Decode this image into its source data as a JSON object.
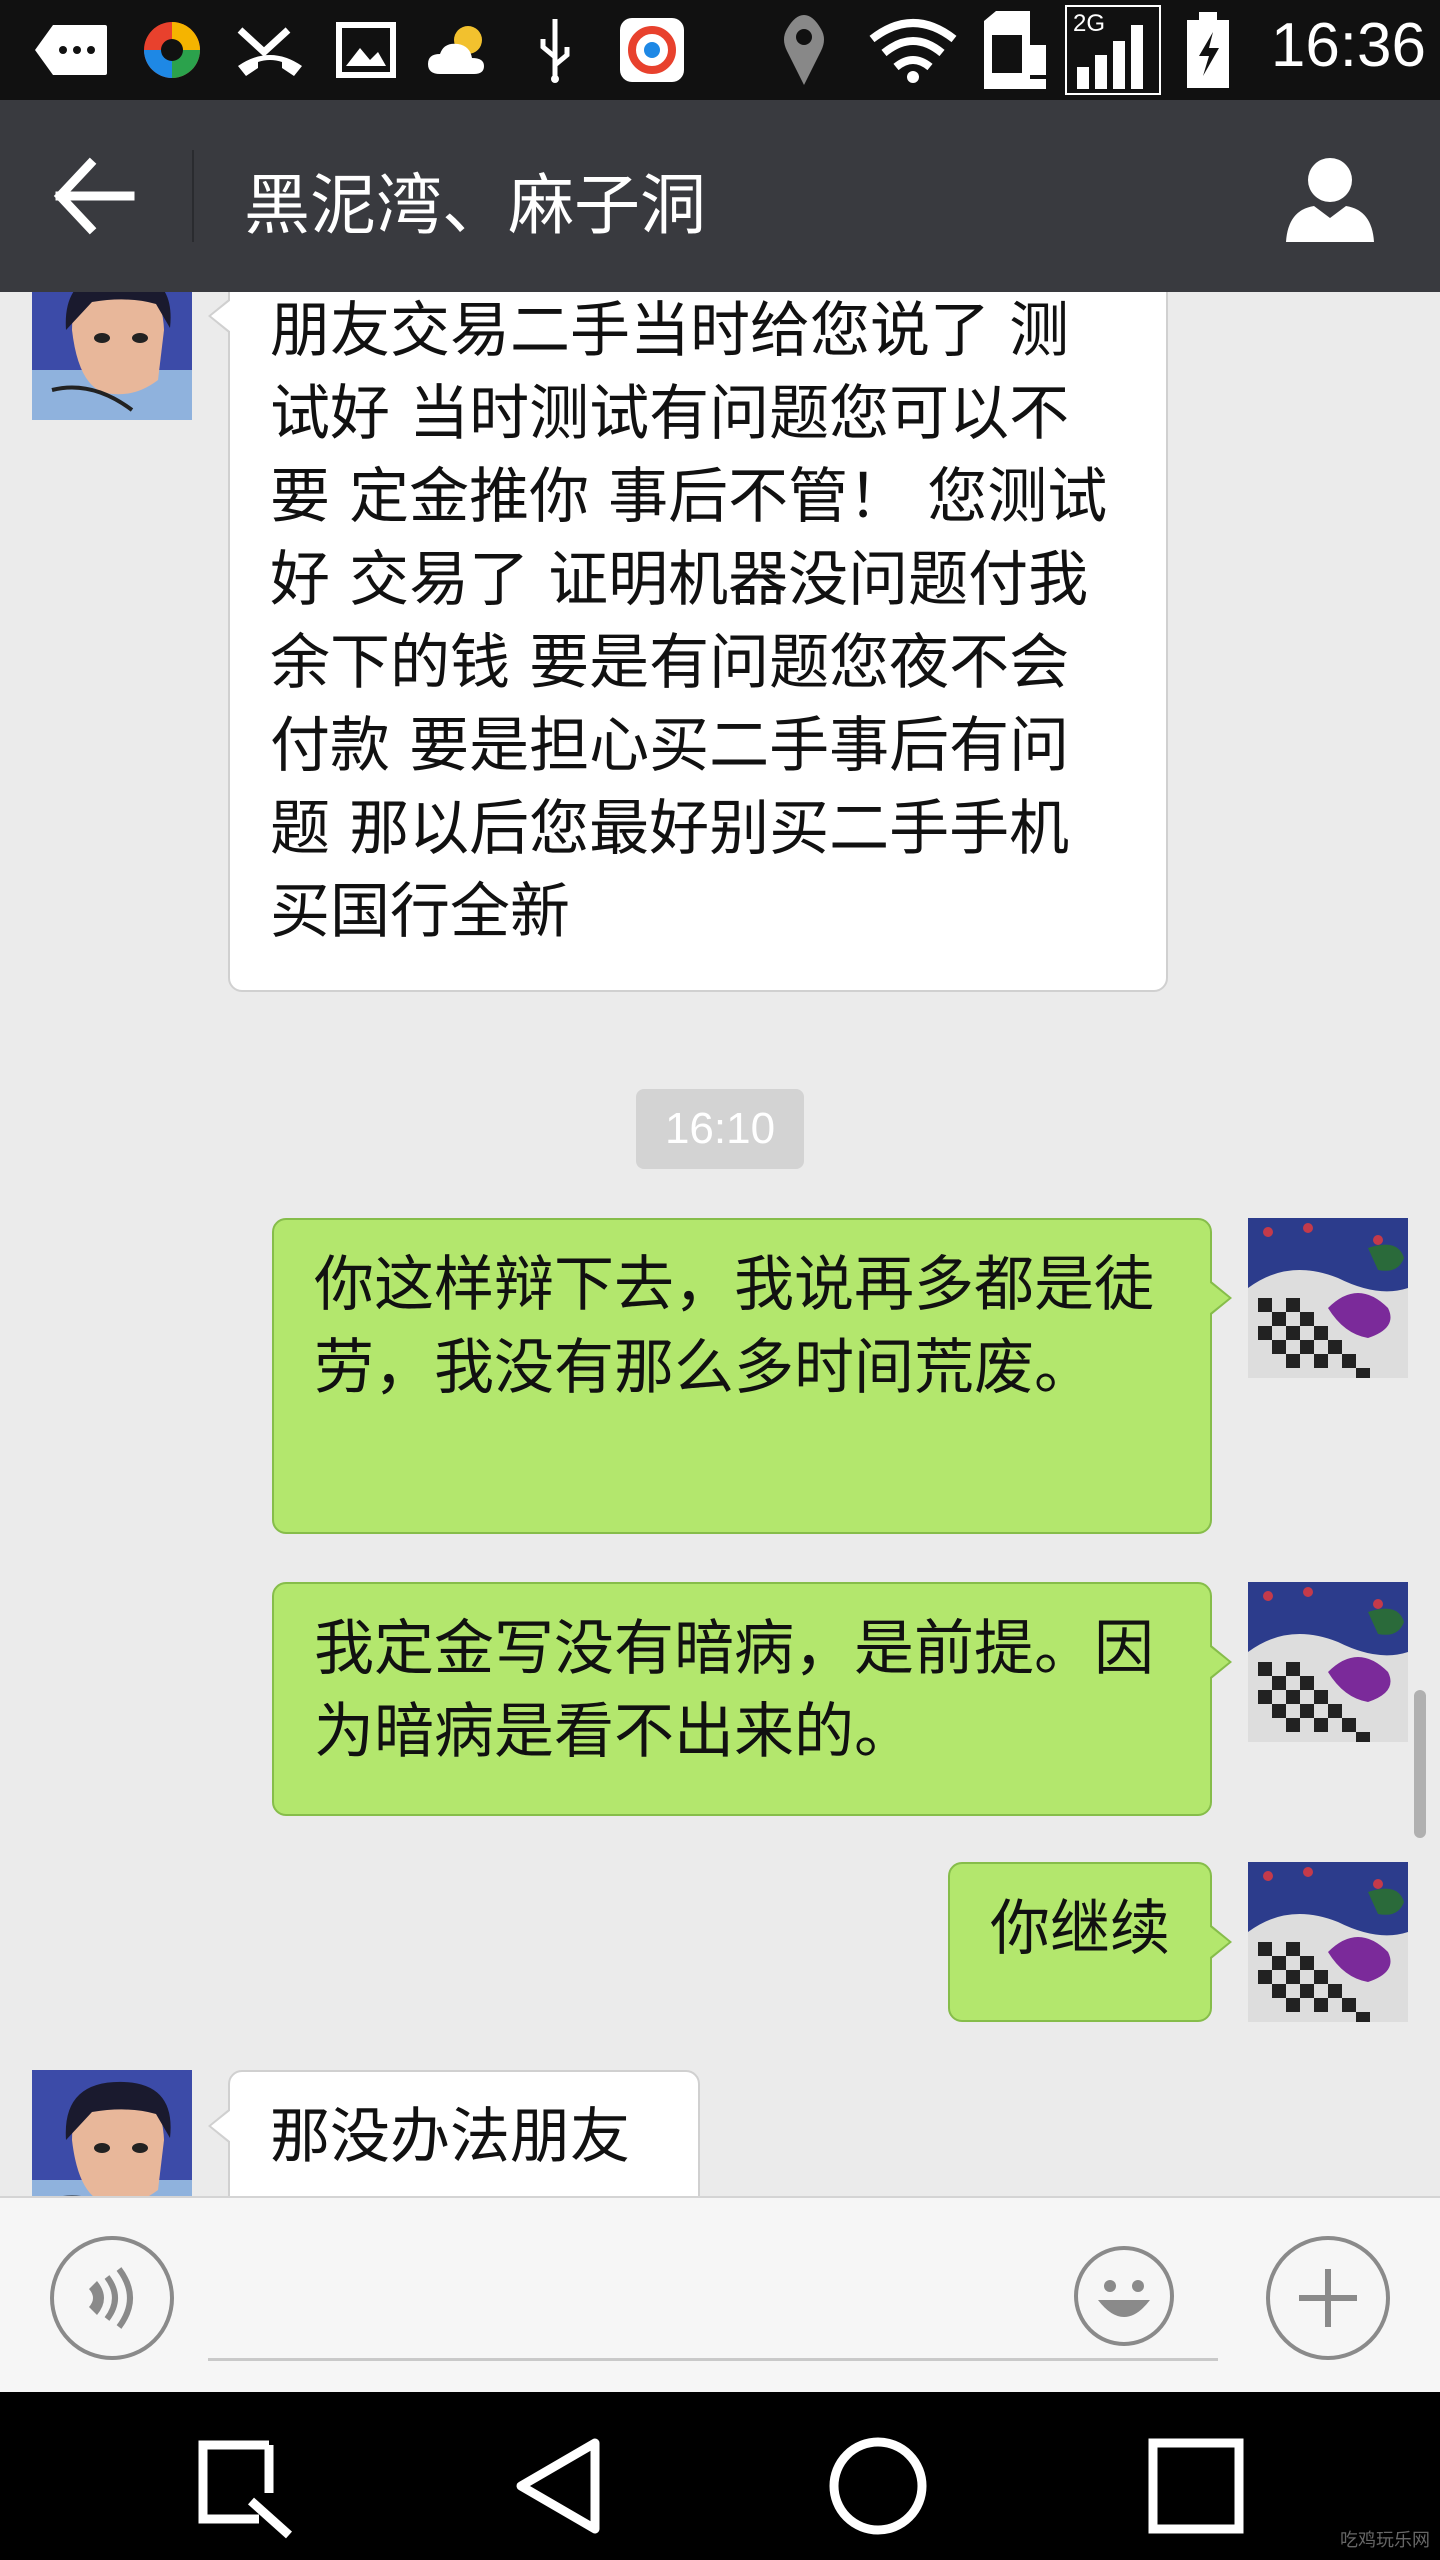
{
  "status_bar": {
    "time": "16:36",
    "network": "2G",
    "icons": [
      "keyboard-icon",
      "app-ball-icon",
      "missed-call-icon",
      "image-icon",
      "weather-icon",
      "usb-icon",
      "app-icon",
      "location-icon",
      "wifi-icon",
      "sim-alert-icon",
      "signal-icon",
      "battery-icon"
    ]
  },
  "title_bar": {
    "title": "黑泥湾、麻子洞",
    "back_icon": "arrow-left-icon",
    "profile_icon": "person-icon"
  },
  "messages": [
    {
      "from": "other",
      "text": "朋友交易二手当时给您说了 测试好 当时测试有问题您可以不要 定金推你 事后不管！ 您测试好 交易了 证明机器没问题付我余下的钱 要是有问题您夜不会付款 要是担心买二手事后有问题 那以后您最好别买二手手机 买国行全新"
    },
    {
      "from": "me",
      "text": "你这样辩下去，我说再多都是徒劳，我没有那么多时间荒废。"
    },
    {
      "from": "me",
      "text": "我定金写没有暗病，是前提。因为暗病是看不出来的。"
    },
    {
      "from": "me",
      "text": "你继续"
    },
    {
      "from": "other",
      "text": "那没办法朋友"
    }
  ],
  "timestamp": "16:10",
  "input_bar": {
    "voice_icon": "voice-icon",
    "emoji_icon": "smiley-icon",
    "plus_icon": "plus-icon",
    "input_value": ""
  },
  "nav_bar": {
    "icons": [
      "search-nav-icon",
      "back-triangle-icon",
      "home-circle-icon",
      "recents-square-icon"
    ]
  },
  "colors": {
    "title_bar": "#393a3f",
    "chat_bg": "#ebebeb",
    "outgoing_bubble": "#b3e76d",
    "incoming_bubble": "#ffffff"
  },
  "watermark": "吃鸡玩乐网"
}
